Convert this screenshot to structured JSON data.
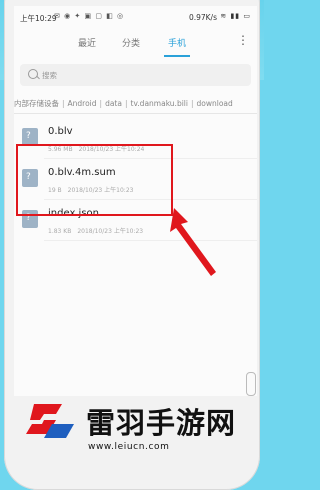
{
  "status_bar": {
    "time": "上午10:29",
    "speed": "0.97K/s"
  },
  "tabs": [
    {
      "label": "最近"
    },
    {
      "label": "分类"
    },
    {
      "label": "手机"
    }
  ],
  "search": {
    "placeholder": "搜索"
  },
  "breadcrumb": [
    "内部存储设备",
    "Android",
    "data",
    "tv.danmaku.bili",
    "download"
  ],
  "files": [
    {
      "name": "0.blv",
      "size": "5.96 MB",
      "date": "2018/10/23 上午10:24"
    },
    {
      "name": "0.blv.4m.sum",
      "size": "19 B",
      "date": "2018/10/23 上午10:23"
    },
    {
      "name": "index.json",
      "size": "1.83 KB",
      "date": "2018/10/23 上午10:23"
    }
  ],
  "watermark": {
    "brand": "雷羽手游网",
    "url": "www.leiucn.com"
  },
  "colors": {
    "accent": "#2aa1d9",
    "highlight": "#e0171d",
    "background": "#6fd6ee"
  }
}
